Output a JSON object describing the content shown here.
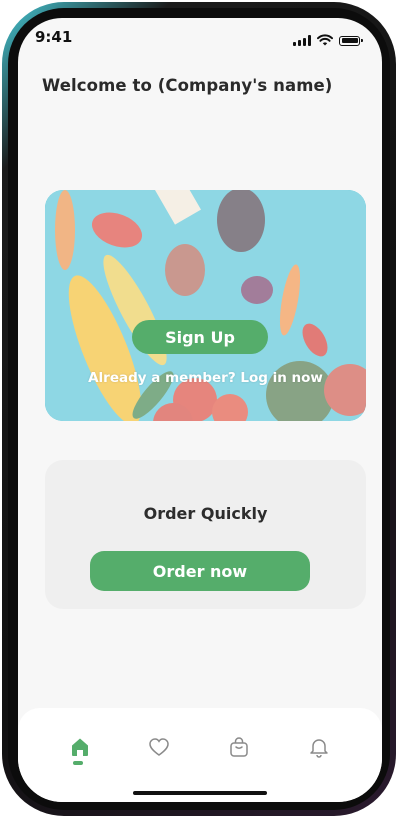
{
  "status_bar": {
    "time": "9:41"
  },
  "header": {
    "welcome_text": "Welcome to (Company's name)"
  },
  "hero": {
    "signup_label": "Sign Up",
    "login_text": "Already a member? Log in now"
  },
  "order_card": {
    "title": "Order Quickly",
    "button_label": "Order now"
  },
  "tab_bar": {
    "items": [
      {
        "icon": "home-icon",
        "active": true
      },
      {
        "icon": "heart-icon",
        "active": false
      },
      {
        "icon": "bag-icon",
        "active": false
      },
      {
        "icon": "bell-icon",
        "active": false
      }
    ]
  },
  "colors": {
    "accent": "#55ad6b",
    "background": "#f7f7f7",
    "card": "#efefef",
    "text": "#2a2a2a"
  }
}
